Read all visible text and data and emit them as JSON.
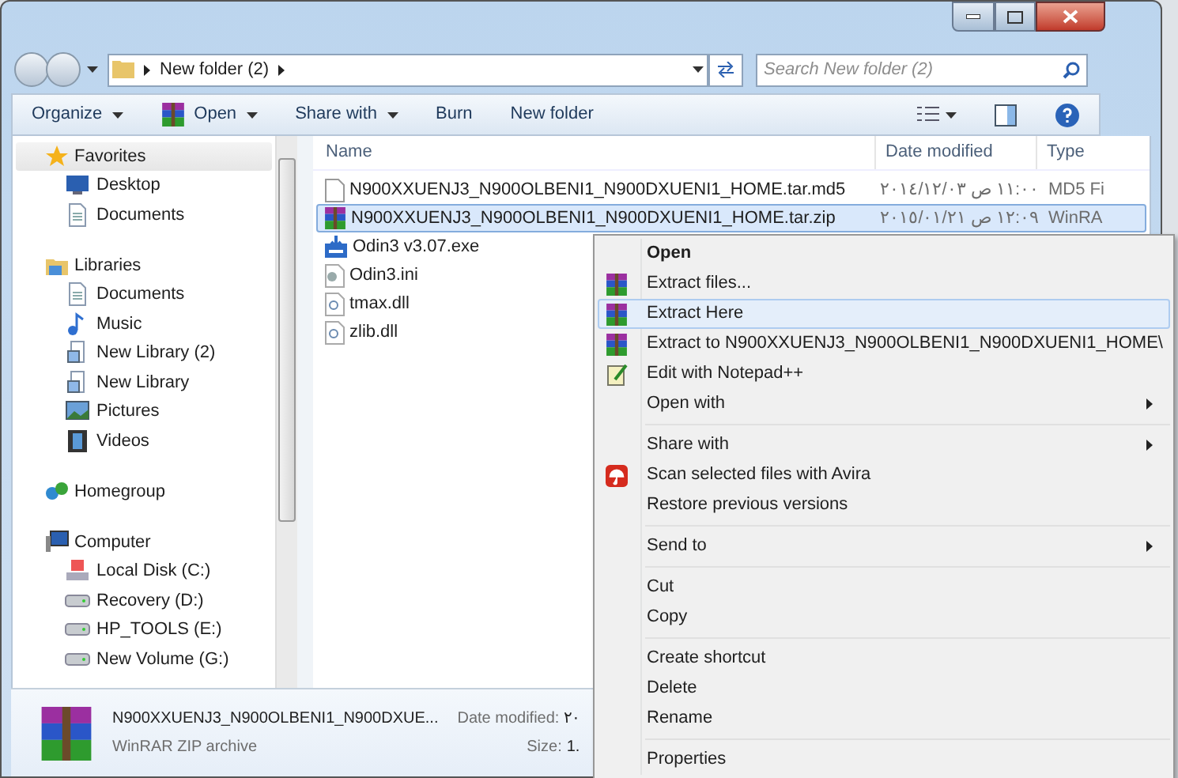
{
  "address_bar": {
    "path": "New folder (2)"
  },
  "search": {
    "placeholder": "Search New folder (2)"
  },
  "toolbar": {
    "items": [
      {
        "label": "Organize",
        "kind": "dropdown"
      },
      {
        "label": "Open",
        "kind": "app-dropdown"
      },
      {
        "label": "Share with",
        "kind": "dropdown"
      },
      {
        "label": "Burn",
        "kind": "plain"
      },
      {
        "label": "New folder",
        "kind": "plain"
      }
    ]
  },
  "navigation": [
    {
      "label": "Favorites",
      "kind": "star",
      "children": [
        {
          "label": "Desktop",
          "kind": "desktop"
        },
        {
          "label": "Documents",
          "kind": "doc"
        }
      ]
    },
    {
      "label": "Libraries",
      "kind": "library",
      "children": [
        {
          "label": "Documents",
          "kind": "doc"
        },
        {
          "label": "Music",
          "kind": "music"
        },
        {
          "label": "New Library (2)",
          "kind": "lib"
        },
        {
          "label": "New Library",
          "kind": "lib"
        },
        {
          "label": "Pictures",
          "kind": "pictures"
        },
        {
          "label": "Videos",
          "kind": "videos"
        }
      ]
    },
    {
      "label": "Homegroup",
      "kind": "homegroup"
    },
    {
      "label": "Computer",
      "kind": "computer",
      "children": [
        {
          "label": "Local Disk (C:)",
          "kind": "osdrive"
        },
        {
          "label": "Recovery (D:)",
          "kind": "drive"
        },
        {
          "label": "HP_TOOLS (E:)",
          "kind": "drive"
        },
        {
          "label": "New Volume (G:)",
          "kind": "drive"
        }
      ]
    }
  ],
  "file_list": {
    "columns": [
      "Name",
      "Date modified",
      "Type"
    ],
    "rows": [
      {
        "name": "N900XXUENJ3_N900OLBENI1_N900DXUENI1_HOME.tar.md5",
        "date": "١١:٠٠ ص ٢٠١٤/١٢/٠٣",
        "type": "MD5 Fi",
        "kind": "blank",
        "selected": false
      },
      {
        "name": "N900XXUENJ3_N900OLBENI1_N900DXUENI1_HOME.tar.zip",
        "date": "١٢:٠٩ ص ٢٠١٥/٠١/٢١",
        "type": "WinRA",
        "kind": "archive",
        "selected": true
      },
      {
        "name": "Odin3 v3.07.exe",
        "kind": "exe",
        "selected": false
      },
      {
        "name": "Odin3.ini",
        "kind": "ini",
        "selected": false
      },
      {
        "name": "tmax.dll",
        "kind": "dll",
        "selected": false
      },
      {
        "name": "zlib.dll",
        "kind": "dll",
        "selected": false
      }
    ]
  },
  "details_pane": {
    "name": "N900XXUENJ3_N900OLBENI1_N900DXUE...",
    "type": "WinRAR ZIP archive",
    "date_label": "Date modified:",
    "date_value": "٢٠",
    "size_label": "Size:",
    "size_value": "1."
  },
  "context_menu": [
    {
      "kind": "default",
      "label": "Open",
      "selected": false
    },
    {
      "kind": "archive",
      "label": "Extract files...",
      "selected": false
    },
    {
      "kind": "archive",
      "label": "Extract Here",
      "selected": true
    },
    {
      "kind": "archive",
      "label": "Extract to N900XXUENJ3_N900OLBENI1_N900DXUENI1_HOME\\",
      "selected": false
    },
    {
      "kind": "editor",
      "label": "Edit with Notepad++",
      "selected": false
    },
    {
      "kind": "submenu",
      "label": "Open with",
      "selected": false
    },
    {
      "kind": "separator"
    },
    {
      "kind": "submenu",
      "label": "Share with",
      "selected": false
    },
    {
      "kind": "antivirus",
      "label": "Scan selected files with Avira",
      "selected": false
    },
    {
      "kind": "plain",
      "label": "Restore previous versions",
      "selected": false
    },
    {
      "kind": "separator"
    },
    {
      "kind": "submenu",
      "label": "Send to",
      "selected": false
    },
    {
      "kind": "separator"
    },
    {
      "kind": "plain",
      "label": "Cut",
      "selected": false
    },
    {
      "kind": "plain",
      "label": "Copy",
      "selected": false
    },
    {
      "kind": "separator"
    },
    {
      "kind": "plain",
      "label": "Create shortcut",
      "selected": false
    },
    {
      "kind": "plain",
      "label": "Delete",
      "selected": false
    },
    {
      "kind": "plain",
      "label": "Rename",
      "selected": false
    },
    {
      "kind": "separator"
    },
    {
      "kind": "plain",
      "label": "Properties",
      "selected": false
    }
  ]
}
